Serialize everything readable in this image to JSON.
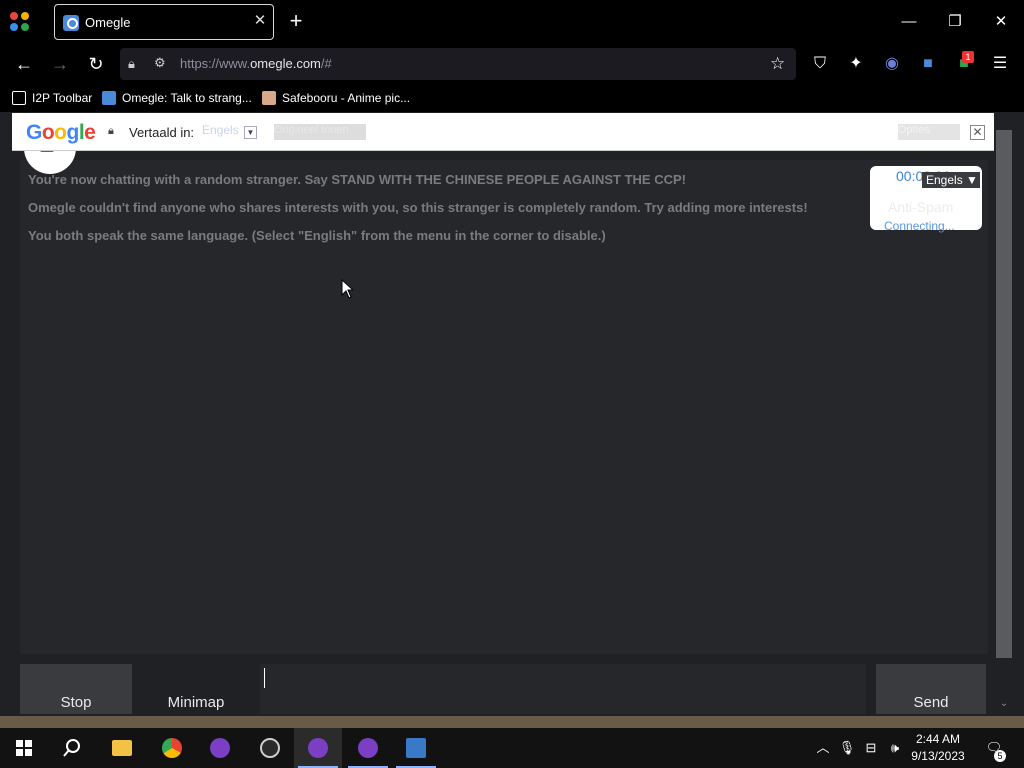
{
  "browser": {
    "tab_title": "Omegle",
    "url_prefix": "https://www.",
    "url_domain": "omegle.com",
    "url_suffix": "/#",
    "bookmarks": [
      {
        "label": "I2P Toolbar"
      },
      {
        "label": "Omegle: Talk to strang..."
      },
      {
        "label": "Safebooru - Anime pic..."
      }
    ],
    "notification_badge": "1"
  },
  "translate_bar": {
    "logo": "Google",
    "translated_into_label": "Vertaald in:",
    "language": "Engels",
    "show_original": "Origineel tonen",
    "options": "Opties"
  },
  "chat": {
    "messages": [
      "You're now chatting with a random stranger. Say STAND WITH THE CHINESE PEOPLE AGAINST THE CCP!",
      "Omegle couldn't find anyone who shares interests with you, so this stranger is completely random. Try adding more interests!",
      "You both speak the same language. (Select \"English\" from the menu in the corner to disable.)"
    ]
  },
  "antispam": {
    "timer": "00:00:00",
    "language_select": "Engels",
    "label": "Anti-Spam",
    "status": "Connecting..."
  },
  "controls": {
    "stop_label": "Stop",
    "minimap_label": "Minimap",
    "send_label": "Send",
    "message_value": ""
  },
  "taskbar": {
    "time": "2:44 AM",
    "date": "9/13/2023",
    "notification_count": "5"
  },
  "colors": {
    "accent_blue": "#3c84d8",
    "page_bg": "#1f2124",
    "chat_bg": "#26272b",
    "button_bg": "#3a3b3f"
  }
}
